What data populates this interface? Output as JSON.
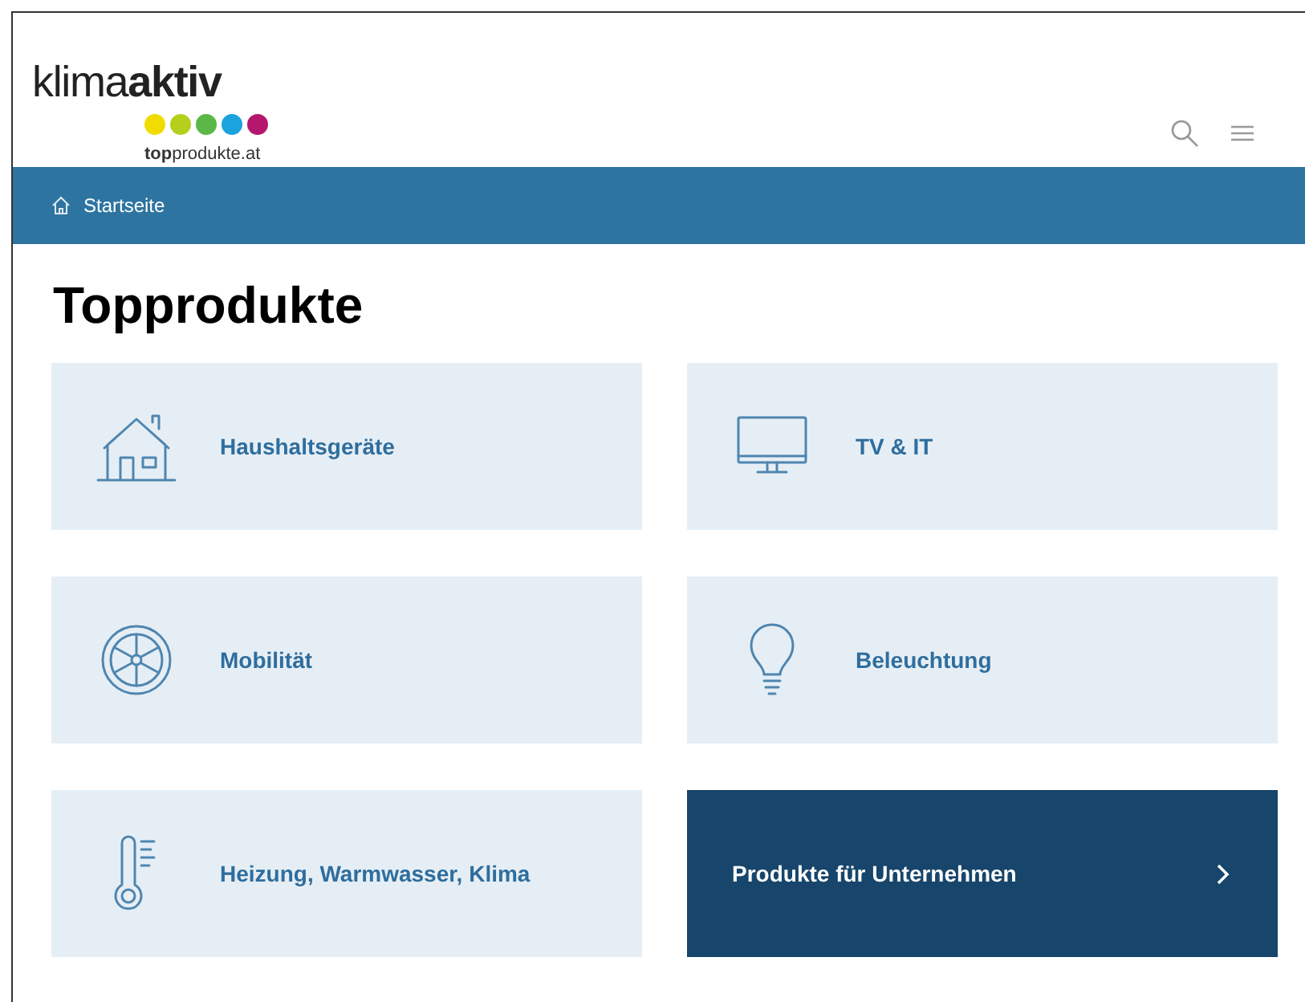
{
  "logo": {
    "wordmark": "klima**aktiv**",
    "dots": [
      {
        "color": "#f2dc00"
      },
      {
        "color": "#b5cf1d"
      },
      {
        "color": "#5bb846"
      },
      {
        "color": "#1aa3dd"
      },
      {
        "color": "#b5176e"
      }
    ],
    "subtitle": "**top**produkte.at"
  },
  "breadcrumb": {
    "items": [
      "Startseite"
    ]
  },
  "title": "Topprodukte",
  "cards": [
    {
      "kind": "category",
      "label": "Haushaltsgeräte"
    },
    {
      "kind": "category",
      "label": "TV & IT"
    },
    {
      "kind": "category",
      "label": "Mobilität"
    },
    {
      "kind": "category",
      "label": "Beleuchtung"
    },
    {
      "kind": "category",
      "label": "Heizung, Warmwasser, Klima"
    },
    {
      "kind": "link",
      "label": "Produkte für Unternehmen"
    }
  ]
}
